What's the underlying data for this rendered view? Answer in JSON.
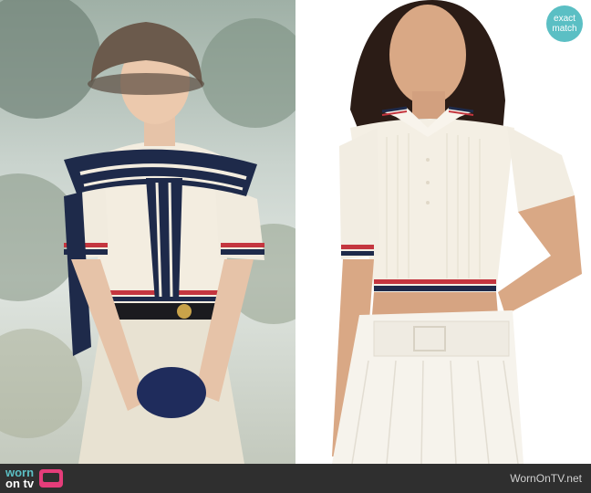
{
  "badge": {
    "line1": "exact",
    "line2": "match"
  },
  "footer": {
    "logo_line1": "worn",
    "logo_line2": "on tv",
    "site": "WornOnTV.net"
  },
  "colors": {
    "badge": "#5bbfc4",
    "footer": "#2f2f2f",
    "logo_accent": "#e53d7a",
    "navy": "#1e2a4a",
    "red_stripe": "#c4363f",
    "knit": "#f4efe4"
  },
  "icons": [
    "tv-icon"
  ]
}
